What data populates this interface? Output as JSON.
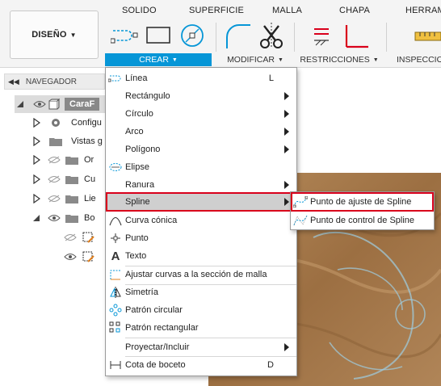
{
  "ribbon": {
    "design_button": "DISEÑO",
    "tabs": [
      "SOLIDO",
      "SUPERFICIE",
      "MALLA",
      "CHAPA",
      "HERRAM"
    ],
    "groups": {
      "crear": "CREAR",
      "modificar": "MODIFICAR",
      "restricciones": "RESTRICCIONES",
      "inspeccion": "INSPECCION"
    },
    "accent_color": "#0696d7"
  },
  "browser": {
    "header": "NAVEGADOR",
    "root_label": "CaraF",
    "items": [
      {
        "label": "Configu",
        "icon": "gear-icon"
      },
      {
        "label": "Vistas g",
        "icon": "folder-icon"
      },
      {
        "label": "Or",
        "icon": "folder-icon"
      },
      {
        "label": "Cu",
        "icon": "folder-icon"
      },
      {
        "label": "Lie",
        "icon": "folder-icon"
      },
      {
        "label": "Bo",
        "icon": "folder-icon"
      }
    ]
  },
  "create_menu": {
    "items": [
      {
        "label": "Línea",
        "shortcut": "L",
        "icon": "line-icon"
      },
      {
        "label": "Rectángulo",
        "submenu": true
      },
      {
        "label": "Círculo",
        "submenu": true
      },
      {
        "label": "Arco",
        "submenu": true
      },
      {
        "label": "Polígono",
        "submenu": true
      },
      {
        "label": "Elipse",
        "icon": "ellipse-icon"
      },
      {
        "label": "Ranura",
        "submenu": true
      },
      {
        "label": "Spline",
        "submenu": true,
        "highlighted": true
      },
      {
        "label": "Curva cónica",
        "icon": "conic-curve-icon"
      },
      {
        "label": "Punto",
        "icon": "point-icon"
      },
      {
        "label": "Texto",
        "icon": "text-icon"
      },
      {
        "label": "Ajustar curvas a la sección de malla",
        "icon": "fit-curves-icon"
      },
      {
        "label": "Simetría",
        "icon": "mirror-icon"
      },
      {
        "label": "Patrón circular",
        "icon": "circular-pattern-icon"
      },
      {
        "label": "Patrón rectangular",
        "icon": "rectangular-pattern-icon"
      },
      {
        "label": "Proyectar/Incluir",
        "submenu": true
      },
      {
        "label": "Cota de boceto",
        "shortcut": "D",
        "icon": "sketch-dimension-icon"
      }
    ]
  },
  "spline_submenu": {
    "items": [
      {
        "label": "Punto de ajuste de Spline",
        "icon": "fit-point-spline-icon"
      },
      {
        "label": "Punto de control de Spline",
        "icon": "control-point-spline-icon"
      }
    ]
  },
  "highlight_color": "#d9001b"
}
